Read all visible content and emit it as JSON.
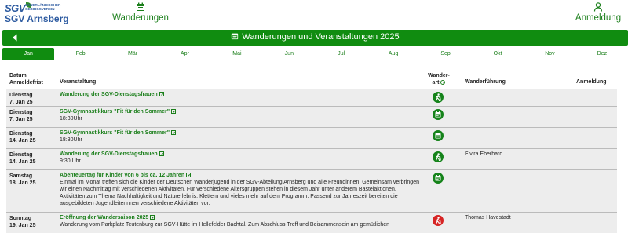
{
  "logo": {
    "brand": "SGV",
    "sub_line1": "SAUERLÄNDISCHER",
    "sub_line2": "GEBIRGSVEREIN",
    "name": "SGV Arnsberg"
  },
  "nav": {
    "wanderungen": "Wanderungen",
    "anmeldung": "Anmeldung"
  },
  "page_title": "Wanderungen und Veranstaltungen 2025",
  "months": [
    "Jan",
    "Feb",
    "Mär",
    "Apr",
    "Mai",
    "Jun",
    "Jul",
    "Aug",
    "Sep",
    "Okt",
    "Nov",
    "Dez"
  ],
  "active_month": "Jan",
  "table": {
    "headers": {
      "datum": "Datum",
      "anmeldefrist": "Anmeldefrist",
      "veranstaltung": "Veranstaltung",
      "wanderart_1": "Wander-",
      "wanderart_2": "art",
      "wanderfuehrung": "Wanderführung",
      "anmeldung": "Anmeldung"
    },
    "rows": [
      {
        "day": "Dienstag",
        "date": "7. Jan 25",
        "title": "Wanderung der SGV-Dienstagsfrauen",
        "lines": [],
        "icon": "hiking-icon",
        "guide": ""
      },
      {
        "day": "Dienstag",
        "date": "7. Jan 25",
        "title": "SGV-Gymnastikkurs \"Fit für den Sommer\"",
        "lines": [
          "18:30Uhr"
        ],
        "icon": "calendar-icon",
        "guide": ""
      },
      {
        "day": "Dienstag",
        "date": "14. Jan 25",
        "title": "SGV-Gymnastikkurs \"Fit für den Sommer\"",
        "lines": [
          "18:30Uhr"
        ],
        "icon": "calendar-icon",
        "guide": ""
      },
      {
        "day": "Dienstag",
        "date": "14. Jan 25",
        "title": "Wanderung der SGV-Dienstagsfrauen",
        "lines": [
          "9:30 Uhr"
        ],
        "icon": "hiking-icon",
        "guide": "Elvira Eberhard"
      },
      {
        "day": "Samstag",
        "date": "18. Jan 25",
        "title": "Abenteuertag für Kinder von 6 bis ca. 12 Jahren",
        "lines": [
          "Einmal im Monat treffen sich die Kinder der Deutschen Wanderjugend in der SGV-Abteilung Arnsberg und alle Freundinnen. Gemeinsam verbringen",
          "wir einen Nachmittag mit verschiedenen Aktivitäten. Für verschiedene Altersgruppen stehen in diesem Jahr unter anderem Bastelaktionen,",
          "Aktivitäten zum Thema Nachhaltigkeit und Naturerlebnis, Klettern und vieles mehr auf dem Programm. Passend zur Jahreszeit bereiten die",
          "ausgebildeten Jugendleiterinnen verschiedene Aktivitäten vor."
        ],
        "icon": "calendar-icon",
        "guide": ""
      },
      {
        "day": "Sonntag",
        "date": "19. Jan 25",
        "title": "Eröffnung der Wandersaison 2025",
        "lines": [
          "Wanderung vom Parkplatz Teutenburg zur SGV-Hütte im Hellefelder Bachtal. Zum Abschluss Treff und Beisammensein am gemütlichen"
        ],
        "icon": "hiking-icon-red",
        "guide": "Thomas Havestadt"
      }
    ]
  },
  "colors": {
    "brand_blue": "#2c5aa0",
    "accent_green": "#108c10",
    "hike_red": "#d62424"
  }
}
